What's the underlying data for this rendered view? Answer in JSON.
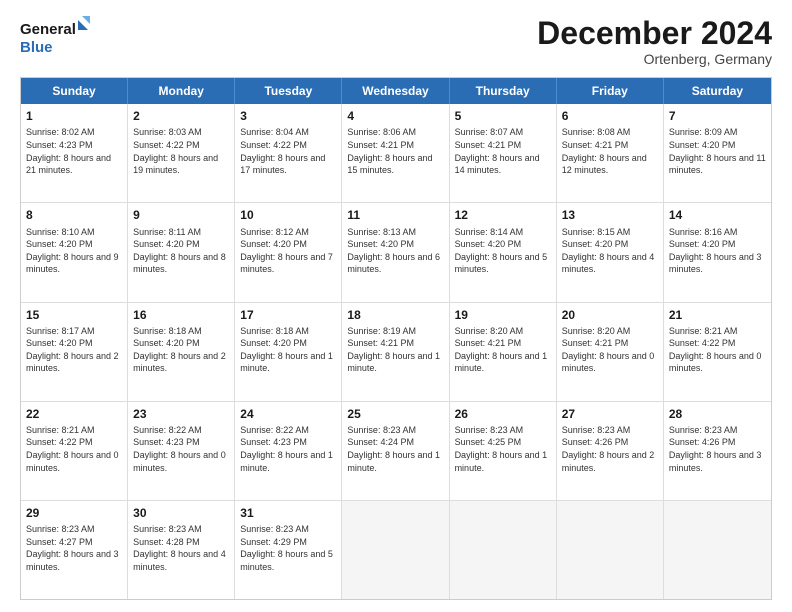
{
  "header": {
    "logo_line1": "General",
    "logo_line2": "Blue",
    "month": "December 2024",
    "location": "Ortenberg, Germany"
  },
  "days": [
    "Sunday",
    "Monday",
    "Tuesday",
    "Wednesday",
    "Thursday",
    "Friday",
    "Saturday"
  ],
  "weeks": [
    [
      {
        "day": "1",
        "rise": "8:02 AM",
        "set": "4:23 PM",
        "daylight": "8 hours and 21 minutes."
      },
      {
        "day": "2",
        "rise": "8:03 AM",
        "set": "4:22 PM",
        "daylight": "8 hours and 19 minutes."
      },
      {
        "day": "3",
        "rise": "8:04 AM",
        "set": "4:22 PM",
        "daylight": "8 hours and 17 minutes."
      },
      {
        "day": "4",
        "rise": "8:06 AM",
        "set": "4:21 PM",
        "daylight": "8 hours and 15 minutes."
      },
      {
        "day": "5",
        "rise": "8:07 AM",
        "set": "4:21 PM",
        "daylight": "8 hours and 14 minutes."
      },
      {
        "day": "6",
        "rise": "8:08 AM",
        "set": "4:21 PM",
        "daylight": "8 hours and 12 minutes."
      },
      {
        "day": "7",
        "rise": "8:09 AM",
        "set": "4:20 PM",
        "daylight": "8 hours and 11 minutes."
      }
    ],
    [
      {
        "day": "8",
        "rise": "8:10 AM",
        "set": "4:20 PM",
        "daylight": "8 hours and 9 minutes."
      },
      {
        "day": "9",
        "rise": "8:11 AM",
        "set": "4:20 PM",
        "daylight": "8 hours and 8 minutes."
      },
      {
        "day": "10",
        "rise": "8:12 AM",
        "set": "4:20 PM",
        "daylight": "8 hours and 7 minutes."
      },
      {
        "day": "11",
        "rise": "8:13 AM",
        "set": "4:20 PM",
        "daylight": "8 hours and 6 minutes."
      },
      {
        "day": "12",
        "rise": "8:14 AM",
        "set": "4:20 PM",
        "daylight": "8 hours and 5 minutes."
      },
      {
        "day": "13",
        "rise": "8:15 AM",
        "set": "4:20 PM",
        "daylight": "8 hours and 4 minutes."
      },
      {
        "day": "14",
        "rise": "8:16 AM",
        "set": "4:20 PM",
        "daylight": "8 hours and 3 minutes."
      }
    ],
    [
      {
        "day": "15",
        "rise": "8:17 AM",
        "set": "4:20 PM",
        "daylight": "8 hours and 2 minutes."
      },
      {
        "day": "16",
        "rise": "8:18 AM",
        "set": "4:20 PM",
        "daylight": "8 hours and 2 minutes."
      },
      {
        "day": "17",
        "rise": "8:18 AM",
        "set": "4:20 PM",
        "daylight": "8 hours and 1 minute."
      },
      {
        "day": "18",
        "rise": "8:19 AM",
        "set": "4:21 PM",
        "daylight": "8 hours and 1 minute."
      },
      {
        "day": "19",
        "rise": "8:20 AM",
        "set": "4:21 PM",
        "daylight": "8 hours and 1 minute."
      },
      {
        "day": "20",
        "rise": "8:20 AM",
        "set": "4:21 PM",
        "daylight": "8 hours and 0 minutes."
      },
      {
        "day": "21",
        "rise": "8:21 AM",
        "set": "4:22 PM",
        "daylight": "8 hours and 0 minutes."
      }
    ],
    [
      {
        "day": "22",
        "rise": "8:21 AM",
        "set": "4:22 PM",
        "daylight": "8 hours and 0 minutes."
      },
      {
        "day": "23",
        "rise": "8:22 AM",
        "set": "4:23 PM",
        "daylight": "8 hours and 0 minutes."
      },
      {
        "day": "24",
        "rise": "8:22 AM",
        "set": "4:23 PM",
        "daylight": "8 hours and 1 minute."
      },
      {
        "day": "25",
        "rise": "8:23 AM",
        "set": "4:24 PM",
        "daylight": "8 hours and 1 minute."
      },
      {
        "day": "26",
        "rise": "8:23 AM",
        "set": "4:25 PM",
        "daylight": "8 hours and 1 minute."
      },
      {
        "day": "27",
        "rise": "8:23 AM",
        "set": "4:26 PM",
        "daylight": "8 hours and 2 minutes."
      },
      {
        "day": "28",
        "rise": "8:23 AM",
        "set": "4:26 PM",
        "daylight": "8 hours and 3 minutes."
      }
    ],
    [
      {
        "day": "29",
        "rise": "8:23 AM",
        "set": "4:27 PM",
        "daylight": "8 hours and 3 minutes."
      },
      {
        "day": "30",
        "rise": "8:23 AM",
        "set": "4:28 PM",
        "daylight": "8 hours and 4 minutes."
      },
      {
        "day": "31",
        "rise": "8:23 AM",
        "set": "4:29 PM",
        "daylight": "8 hours and 5 minutes."
      },
      null,
      null,
      null,
      null
    ]
  ],
  "labels": {
    "sunrise": "Sunrise:",
    "sunset": "Sunset:",
    "daylight": "Daylight:"
  }
}
